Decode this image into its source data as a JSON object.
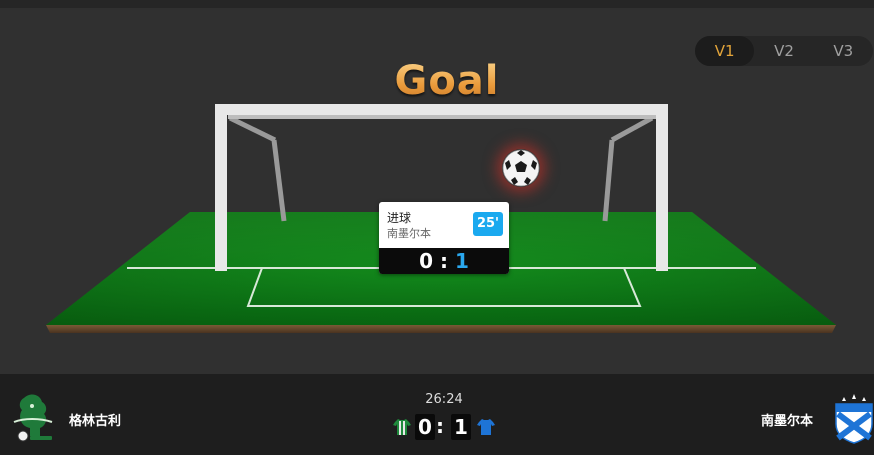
{
  "header": {
    "title": "Goal",
    "versions": [
      {
        "label": "V1",
        "active": true
      },
      {
        "label": "V2",
        "active": false
      },
      {
        "label": "V3",
        "active": false
      }
    ]
  },
  "event": {
    "type": "进球",
    "team": "南墨尔本",
    "minute": "25'",
    "score_home": "0",
    "score_separator": ":",
    "score_away": "1"
  },
  "match": {
    "time": "26:24",
    "home": {
      "name": "格林古利",
      "score": "0",
      "jersey_color": "#1f8a3c"
    },
    "away": {
      "name": "南墨尔本",
      "score": "1",
      "jersey_color": "#1e74d6"
    },
    "separator": ":"
  },
  "colors": {
    "accent": "#e4a53a",
    "minute_badge": "#1aa9ef",
    "pitch": "#0f8a1c"
  },
  "icons": {
    "ball": "soccer-ball-icon",
    "home_logo": "home-team-logo",
    "away_logo": "away-team-logo"
  }
}
